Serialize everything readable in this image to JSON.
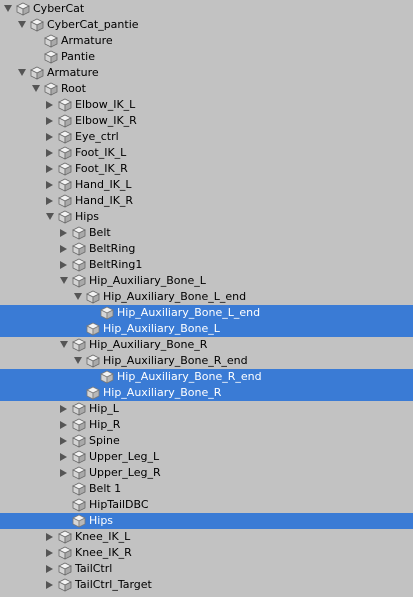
{
  "hierarchy": [
    {
      "label": "CyberCat",
      "depth": 0,
      "expander": "down",
      "selected": false
    },
    {
      "label": "CyberCat_pantie",
      "depth": 1,
      "expander": "down",
      "selected": false
    },
    {
      "label": "Armature",
      "depth": 2,
      "expander": "none",
      "selected": false
    },
    {
      "label": "Pantie",
      "depth": 2,
      "expander": "none",
      "selected": false
    },
    {
      "label": "Armature",
      "depth": 1,
      "expander": "down",
      "selected": false
    },
    {
      "label": "Root",
      "depth": 2,
      "expander": "down",
      "selected": false
    },
    {
      "label": "Elbow_IK_L",
      "depth": 3,
      "expander": "right",
      "selected": false
    },
    {
      "label": "Elbow_IK_R",
      "depth": 3,
      "expander": "right",
      "selected": false
    },
    {
      "label": "Eye_ctrl",
      "depth": 3,
      "expander": "right",
      "selected": false
    },
    {
      "label": "Foot_IK_L",
      "depth": 3,
      "expander": "right",
      "selected": false
    },
    {
      "label": "Foot_IK_R",
      "depth": 3,
      "expander": "right",
      "selected": false
    },
    {
      "label": "Hand_IK_L",
      "depth": 3,
      "expander": "right",
      "selected": false
    },
    {
      "label": "Hand_IK_R",
      "depth": 3,
      "expander": "right",
      "selected": false
    },
    {
      "label": "Hips",
      "depth": 3,
      "expander": "down",
      "selected": false
    },
    {
      "label": "Belt",
      "depth": 4,
      "expander": "right",
      "selected": false
    },
    {
      "label": "BeltRing",
      "depth": 4,
      "expander": "right",
      "selected": false
    },
    {
      "label": "BeltRing1",
      "depth": 4,
      "expander": "right",
      "selected": false
    },
    {
      "label": "Hip_Auxiliary_Bone_L",
      "depth": 4,
      "expander": "down",
      "selected": false
    },
    {
      "label": "Hip_Auxiliary_Bone_L_end",
      "depth": 5,
      "expander": "down",
      "selected": false
    },
    {
      "label": "Hip_Auxiliary_Bone_L_end",
      "depth": 6,
      "expander": "none",
      "selected": true
    },
    {
      "label": "Hip_Auxiliary_Bone_L",
      "depth": 5,
      "expander": "none",
      "selected": true
    },
    {
      "label": "Hip_Auxiliary_Bone_R",
      "depth": 4,
      "expander": "down",
      "selected": false
    },
    {
      "label": "Hip_Auxiliary_Bone_R_end",
      "depth": 5,
      "expander": "down",
      "selected": false
    },
    {
      "label": "Hip_Auxiliary_Bone_R_end",
      "depth": 6,
      "expander": "none",
      "selected": true
    },
    {
      "label": "Hip_Auxiliary_Bone_R",
      "depth": 5,
      "expander": "none",
      "selected": true
    },
    {
      "label": "Hip_L",
      "depth": 4,
      "expander": "right",
      "selected": false
    },
    {
      "label": "Hip_R",
      "depth": 4,
      "expander": "right",
      "selected": false
    },
    {
      "label": "Spine",
      "depth": 4,
      "expander": "right",
      "selected": false
    },
    {
      "label": "Upper_Leg_L",
      "depth": 4,
      "expander": "right",
      "selected": false
    },
    {
      "label": "Upper_Leg_R",
      "depth": 4,
      "expander": "right",
      "selected": false
    },
    {
      "label": "Belt 1",
      "depth": 4,
      "expander": "none",
      "selected": false
    },
    {
      "label": "HipTailDBC",
      "depth": 4,
      "expander": "none",
      "selected": false
    },
    {
      "label": "Hips",
      "depth": 4,
      "expander": "none",
      "selected": true
    },
    {
      "label": "Knee_IK_L",
      "depth": 3,
      "expander": "right",
      "selected": false
    },
    {
      "label": "Knee_IK_R",
      "depth": 3,
      "expander": "right",
      "selected": false
    },
    {
      "label": "TailCtrl",
      "depth": 3,
      "expander": "right",
      "selected": false
    },
    {
      "label": "TailCtrl_Target",
      "depth": 3,
      "expander": "right",
      "selected": false
    }
  ],
  "icons": {
    "gameobject": "cube-icon",
    "expand": "chevron-right-icon",
    "collapse": "chevron-down-icon"
  },
  "colors": {
    "background": "#c2c2c2",
    "selection": "#3a7bd5",
    "selected_text": "#ffffff",
    "text": "#000000"
  }
}
